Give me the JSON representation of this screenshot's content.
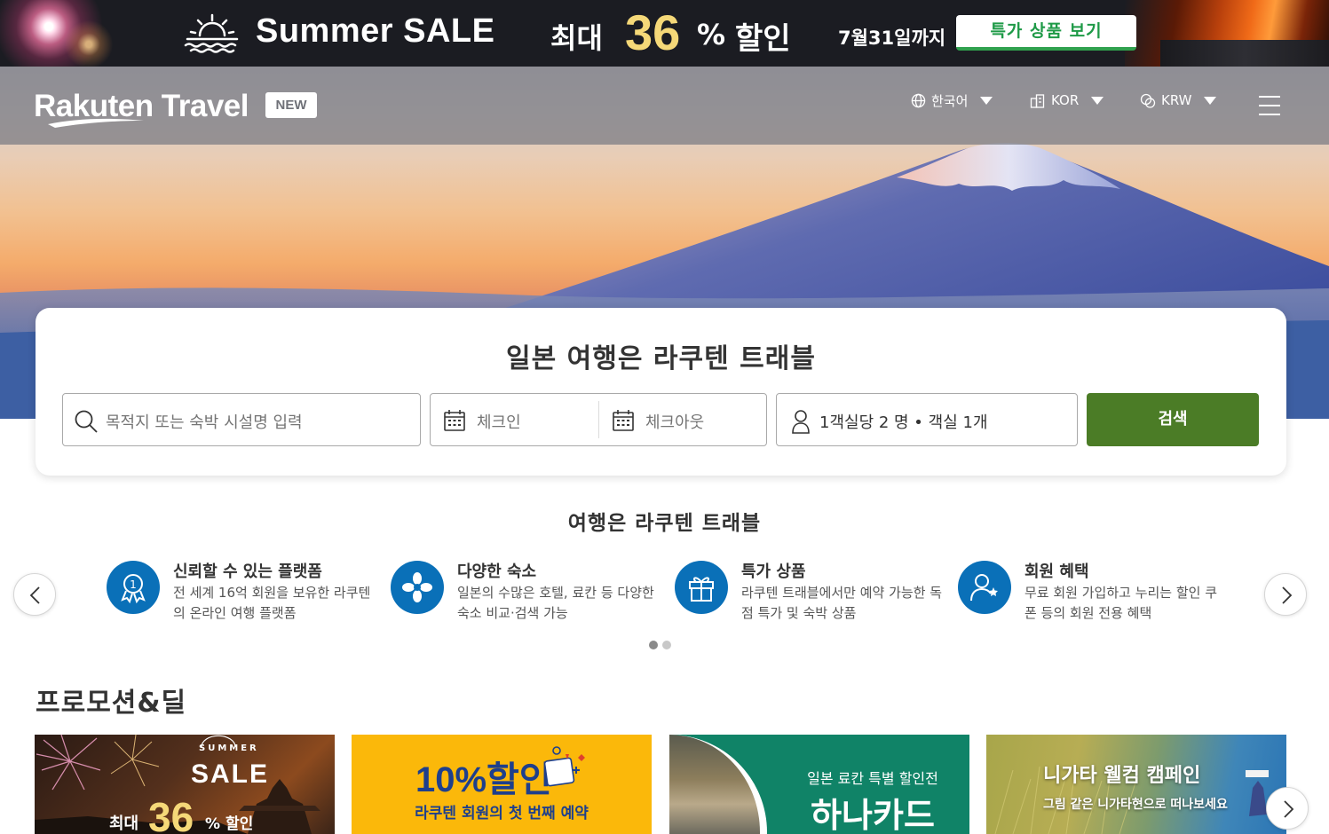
{
  "banner": {
    "title": "Summer SALE",
    "max_label": "최대",
    "percent": "36",
    "percent_sign": "%",
    "off_label": "할인",
    "until": "7월31일까지",
    "cta": "특가 상품 보기"
  },
  "header": {
    "logo": "Rakuten Travel",
    "badge": "NEW",
    "language": "한국어",
    "region": "KOR",
    "currency": "KRW",
    "menu_icon": "hamburger-icon"
  },
  "search": {
    "title": "일본 여행은 라쿠텐 트래블",
    "destination_placeholder": "목적지 또는 숙박 시설명 입력",
    "checkin_placeholder": "체크인",
    "checkout_placeholder": "체크아웃",
    "guests": "1객실당 2 명 • 객실 1개",
    "button": "검색"
  },
  "features": {
    "heading": "여행은 라쿠텐 트래블",
    "items": [
      {
        "title": "신뢰할 수 있는 플랫폼",
        "desc": "전 세계 16억 회원을 보유한 라쿠텐의 온라인 여행 플랫폼",
        "icon": "award-badge-icon"
      },
      {
        "title": "다양한 숙소",
        "desc": "일본의 수많은 호텔, 료칸 등 다양한 숙소 비교·검색 가능",
        "icon": "flower-icon"
      },
      {
        "title": "특가 상품",
        "desc": "라쿠텐 트래블에서만 예약 가능한 독점 특가 및 숙박 상품",
        "icon": "gift-icon"
      },
      {
        "title": "회원 혜택",
        "desc": "무료 회원 가입하고 누리는 할인 쿠폰 등의 회원 전용 혜택",
        "icon": "user-star-icon"
      }
    ],
    "page_count": 2,
    "active_page": 1
  },
  "promotions": {
    "heading": "프로모션&딜",
    "card1": {
      "summer": "SUMMER",
      "sale": "SALE",
      "max": "최대",
      "percent": "36",
      "off": "% 할인"
    },
    "card2": {
      "big": "10%할인",
      "sub": "라쿠텐 회원의 첫 번째 예약"
    },
    "card3": {
      "sub": "일본 료칸 특별 할인전",
      "big": "하나카드"
    },
    "card4": {
      "title": "니가타 웰컴 캠페인",
      "sub": "그림 같은 니가타현으로 떠나보세요"
    }
  },
  "colors": {
    "brand_green": "#4b7c26",
    "cta_green": "#1e9a47",
    "feature_blue": "#0a70b8",
    "banner_bg": "#1b1c22",
    "promo_yellow": "#fbb80a",
    "promo_teal": "#108367"
  }
}
